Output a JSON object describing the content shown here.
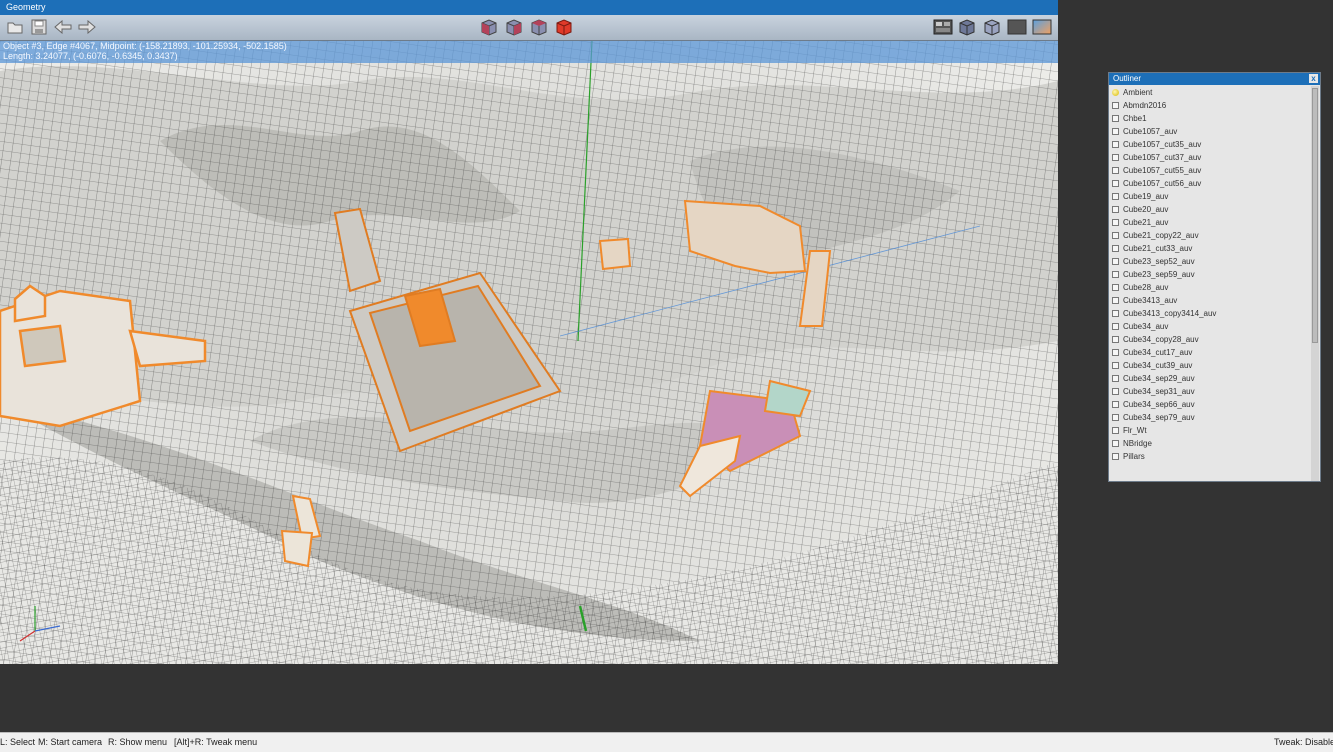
{
  "window": {
    "title": "Geometry",
    "info_line1": "Object #3, Edge #4067, Midpoint: (-158.21893, -101.25934, -502.1585)",
    "info_line2": "Length: 3.24077, (-0.6076, -0.6345, 0.3437)"
  },
  "toolbar": {
    "icons": [
      "open-folder-icon",
      "save-icon",
      "undo-arrow-icon",
      "redo-arrow-icon",
      "view-cube-front-icon",
      "view-cube-side-icon",
      "view-cube-top-icon",
      "view-cube-solid-icon",
      "render-settings-icon",
      "shaded-cube-icon",
      "wire-cube-icon",
      "background-icon",
      "gradient-icon"
    ]
  },
  "outliner": {
    "title": "Outliner",
    "close_label": "x",
    "items": [
      "Ambient",
      "Abmdn2016",
      "Chbe1",
      "Cube1057_auv",
      "Cube1057_cut35_auv",
      "Cube1057_cut37_auv",
      "Cube1057_cut55_auv",
      "Cube1057_cut56_auv",
      "Cube19_auv",
      "Cube20_auv",
      "Cube21_auv",
      "Cube21_copy22_auv",
      "Cube21_cut33_auv",
      "Cube23_sep52_auv",
      "Cube23_sep59_auv",
      "Cube28_auv",
      "Cube3413_auv",
      "Cube3413_copy3414_auv",
      "Cube34_auv",
      "Cube34_copy28_auv",
      "Cube34_cut17_auv",
      "Cube34_cut39_auv",
      "Cube34_sep29_auv",
      "Cube34_sep31_auv",
      "Cube34_sep66_auv",
      "Cube34_sep79_auv",
      "Flr_Wt",
      "NBridge",
      "Pillars"
    ]
  },
  "statusbar": {
    "select": "L: Select",
    "camera": "M: Start camera",
    "show_menu": "R: Show menu",
    "tweak_menu": "[Alt]+R: Tweak menu",
    "tweak_state": "Tweak: Disabled"
  },
  "colors": {
    "title_blue": "#1d6fb8",
    "selection_orange": "#f08a2c",
    "background": "#333333"
  }
}
